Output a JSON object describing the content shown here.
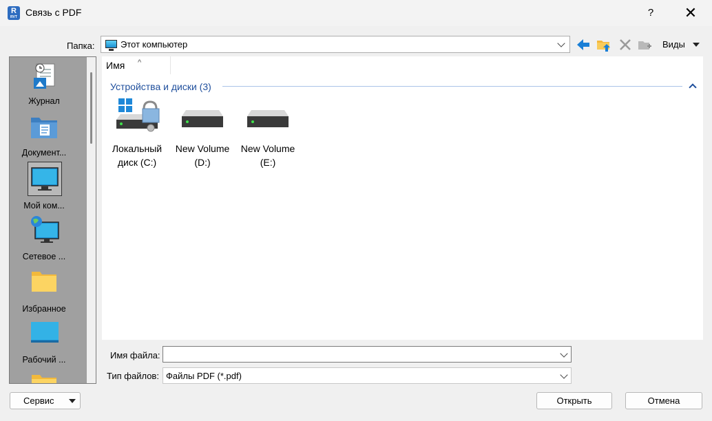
{
  "window": {
    "title": "Связь с PDF",
    "help_label": "?",
    "close_label": "✕"
  },
  "toolbar": {
    "folder_label": "Папка:",
    "folder_value": "Этот компьютер",
    "views_label": "Виды",
    "icons": [
      "back-arrow-icon",
      "up-folder-icon",
      "delete-icon",
      "new-folder-icon"
    ]
  },
  "places": [
    {
      "label": "Журнал",
      "icon": "history-icon"
    },
    {
      "label": "Документ...",
      "icon": "documents-icon"
    },
    {
      "label": "Мой ком...",
      "icon": "computer-icon",
      "selected": true
    },
    {
      "label": "Сетевое ...",
      "icon": "network-icon"
    },
    {
      "label": "Избранное",
      "icon": "favorites-folder-icon"
    },
    {
      "label": "Рабочий ...",
      "icon": "desktop-icon"
    }
  ],
  "filelist": {
    "column_name": "Имя",
    "sort_indicator": "^",
    "group_title": "Устройства и диски (3)",
    "drives": [
      {
        "line1": "Локальный",
        "line2": "диск (C:)",
        "icon": "system-drive-icon"
      },
      {
        "line1": "New Volume",
        "line2": "(D:)",
        "icon": "drive-icon"
      },
      {
        "line1": "New Volume",
        "line2": "(E:)",
        "icon": "drive-icon"
      }
    ]
  },
  "bottom": {
    "filename_label": "Имя файла:",
    "filename_value": "",
    "filetype_label": "Тип файлов:",
    "filetype_value": "Файлы PDF (*.pdf)",
    "service_label": "Сервис",
    "open_label": "Открыть",
    "cancel_label": "Отмена"
  },
  "colors": {
    "accent": "#1e4e9c",
    "places_bg": "#a0a0a0"
  }
}
